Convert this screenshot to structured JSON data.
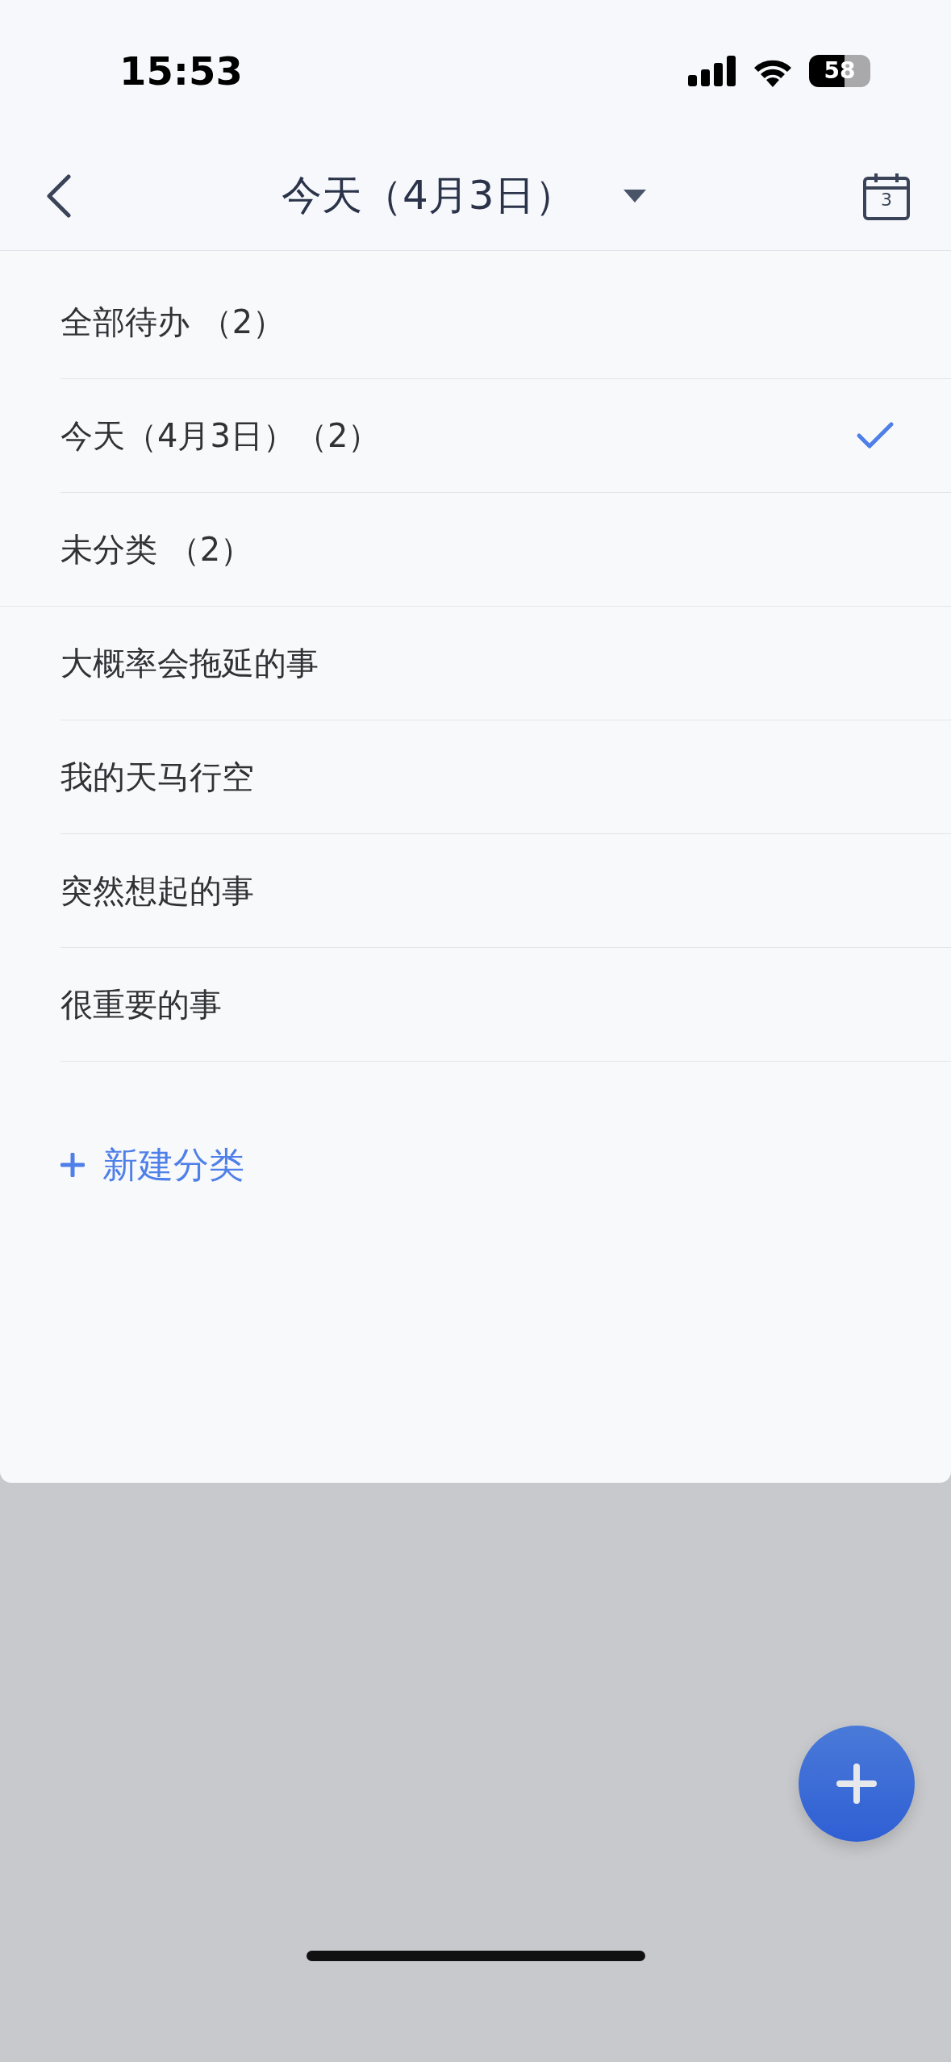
{
  "status_bar": {
    "time": "15:53",
    "battery": "58"
  },
  "nav_bar": {
    "title": "今天（4月3日）",
    "calendar_day": "3"
  },
  "filters": [
    {
      "label": "全部待办 （2）",
      "selected": false
    },
    {
      "label": "今天（4月3日）（2）",
      "selected": true
    },
    {
      "label": "未分类 （2）",
      "selected": false
    }
  ],
  "categories": [
    {
      "label": "大概率会拖延的事",
      "selected": false
    },
    {
      "label": "我的天马行空",
      "selected": false
    },
    {
      "label": "突然想起的事",
      "selected": false
    },
    {
      "label": "很重要的事",
      "selected": false
    }
  ],
  "new_category": {
    "label": "新建分类"
  }
}
